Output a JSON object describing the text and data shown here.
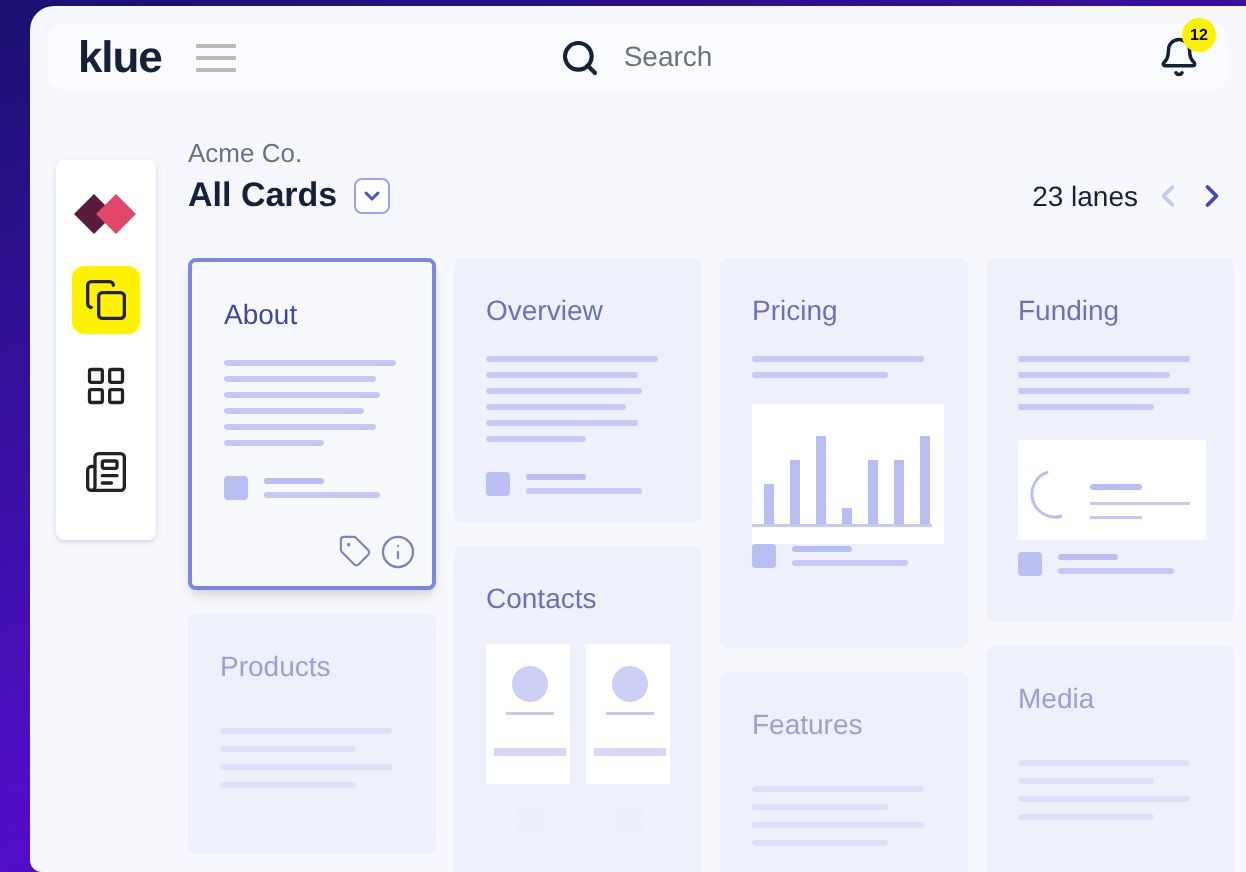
{
  "header": {
    "logo": "klue",
    "search": {
      "placeholder": "Search"
    },
    "notifications": {
      "count": "12"
    }
  },
  "sidebar": {
    "items": [
      {
        "kind": "logo",
        "selected": false
      },
      {
        "kind": "cards",
        "selected": true
      },
      {
        "kind": "grid",
        "selected": false
      },
      {
        "kind": "news",
        "selected": false
      }
    ]
  },
  "board": {
    "company": "Acme Co.",
    "title": "All Cards",
    "lanes": "23 lanes",
    "prev_disabled": true
  },
  "lanes": [
    {
      "cards": [
        {
          "title": "About",
          "kind": "profile",
          "selected": true,
          "faded": false
        },
        {
          "title": "Products",
          "kind": "list",
          "selected": false,
          "faded": true
        }
      ]
    },
    {
      "cards": [
        {
          "title": "Overview",
          "kind": "summary",
          "selected": false,
          "faded": false
        },
        {
          "title": "Contacts",
          "kind": "contacts",
          "selected": false,
          "faded": false
        }
      ]
    },
    {
      "cards": [
        {
          "title": "Pricing",
          "kind": "chart",
          "selected": false,
          "faded": false
        },
        {
          "title": "Features",
          "kind": "list",
          "selected": false,
          "faded": true
        }
      ]
    },
    {
      "cards": [
        {
          "title": "Funding",
          "kind": "donut",
          "selected": false,
          "faded": false
        },
        {
          "title": "Media",
          "kind": "list",
          "selected": false,
          "faded": true
        }
      ]
    }
  ]
}
